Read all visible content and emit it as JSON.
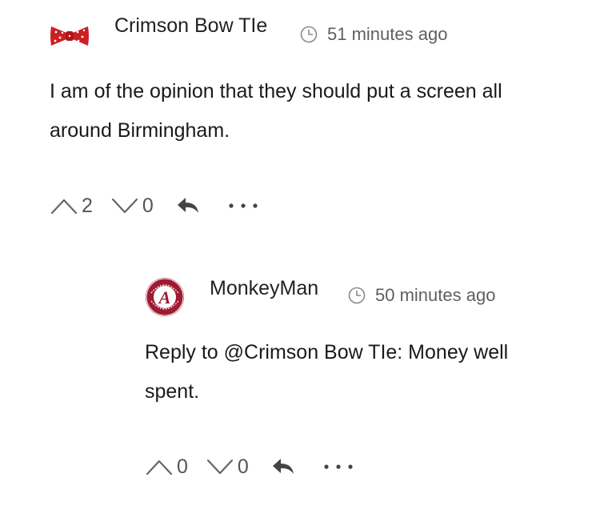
{
  "comments": [
    {
      "username": "Crimson Bow TIe",
      "time": "51 minutes ago",
      "text": "I am of the opinion that they should put a screen all around Birmingham.",
      "upvotes": "2",
      "downvotes": "0",
      "avatar": "bow-tie-icon"
    },
    {
      "username": "MonkeyMan",
      "time": "50 minutes ago",
      "text": "Reply to @Crimson Bow TIe: Money well spent.",
      "upvotes": "0",
      "downvotes": "0",
      "avatar": "alabama-crimson-tide-logo",
      "logo_text": "ALABAMA CRIMSON TIDE"
    }
  ],
  "colors": {
    "bow_red": "#cc1f24",
    "alabama_crimson": "#9e1b32",
    "text": "#1a1a1a",
    "meta": "#5f5f5f"
  }
}
